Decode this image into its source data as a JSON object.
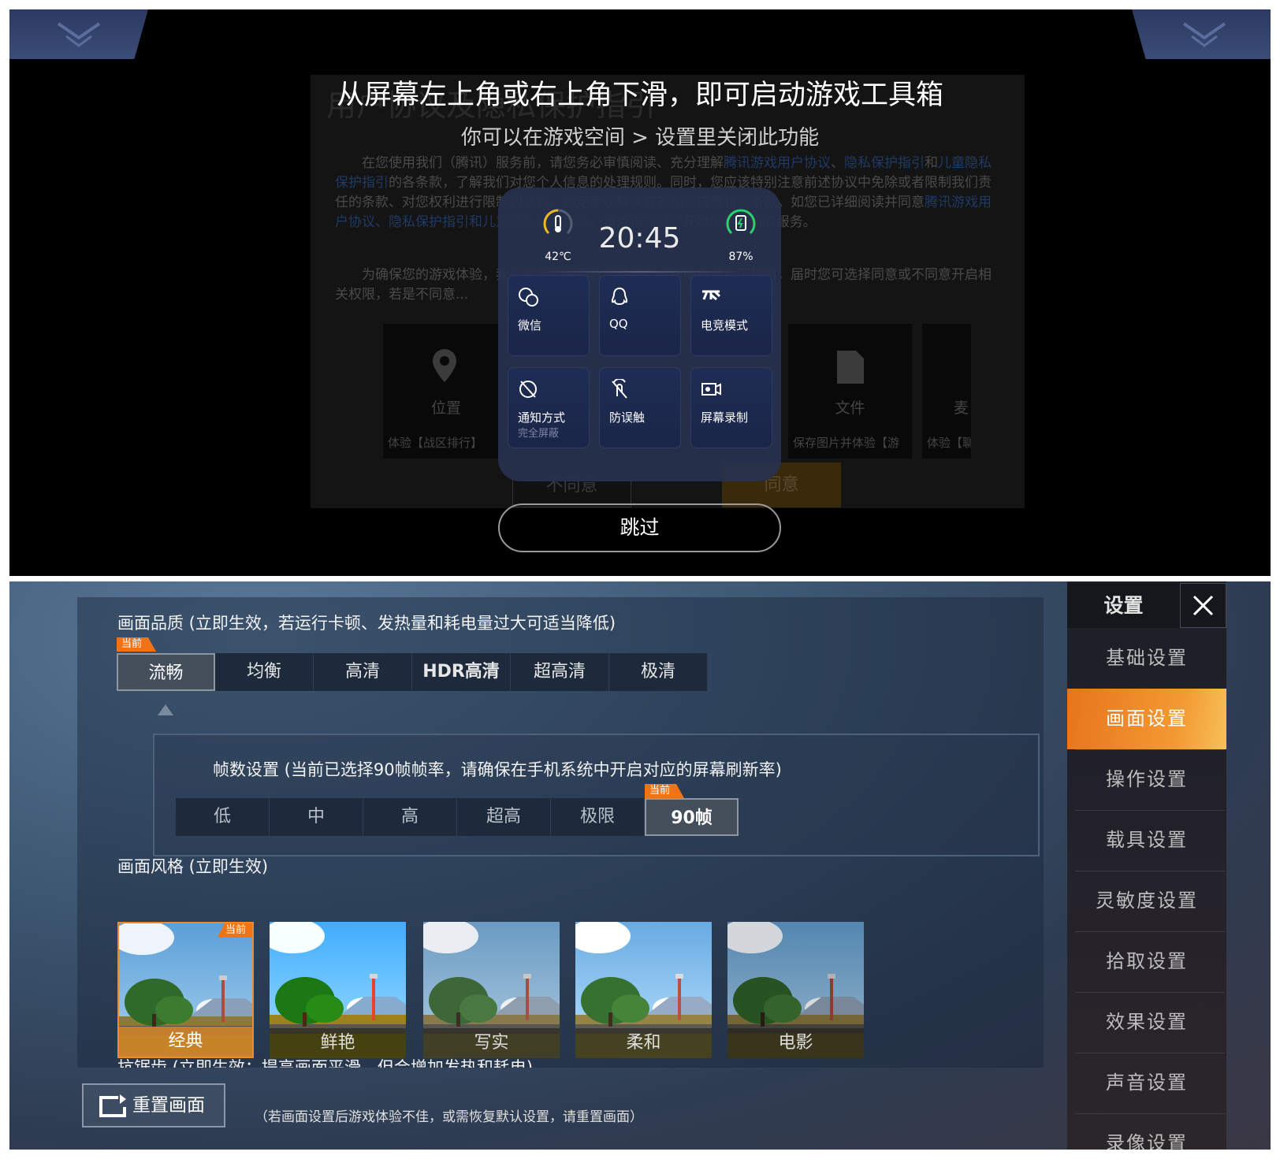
{
  "overlay": {
    "title": "从屏幕左上角或右上角下滑，即可启动游戏工具箱",
    "subtitle": "你可以在游戏空间 > 设置里关闭此功能",
    "skip_label": "跳过"
  },
  "agreement": {
    "title": "用户协议及隐私保护指引",
    "p1_a": "在您使用我们（腾讯）服务前，请您务必审慎阅读、充分理解",
    "p1_link1": "腾讯游戏用户协议",
    "p1_b": "、",
    "p1_link2": "隐私保护指引",
    "p1_c": "和",
    "p1_link3": "儿童隐私保护指引",
    "p1_d": "的各条款，了解我们对您个人信息的处理规则。同时，您应该特别注意前述协议中免除或者限制我们责任的条款、对您权利进行限制的条约、约定争议解决方式和司法管辖的条款。如您已详细阅读并同意",
    "p1_link4": "腾讯游戏用户协议、隐私保护指引和儿童隐私保护指引",
    "p1_e": "，请点击\"同意\"开始使用我们的服务。",
    "p2": "为确保您的游戏体验，我们将在您使用我们的服务过程中申请以下权限，届时您可选择同意或不同意开启相关权限，若是不同意...",
    "permissions": [
      {
        "label": "位置",
        "desc": "体验【战区排行】",
        "icon": "location-pin-icon"
      },
      {
        "label": "文件",
        "desc": "保存图片并体验【游",
        "icon": "file-icon"
      },
      {
        "label": "麦",
        "desc": "体验【聊",
        "icon": "microphone-icon"
      }
    ],
    "disagree_label": "不同意",
    "agree_label": "同意"
  },
  "toolbox": {
    "temperature": "42℃",
    "time": "20:45",
    "battery": "87%",
    "battery_level": 87,
    "tiles": [
      {
        "label": "微信",
        "sub": "",
        "icon": "wechat-icon"
      },
      {
        "label": "QQ",
        "sub": "",
        "icon": "qq-icon"
      },
      {
        "label": "电竞模式",
        "sub": "",
        "icon": "esports-mode-icon"
      },
      {
        "label": "通知方式",
        "sub": "完全屏蔽",
        "icon": "notification-block-icon"
      },
      {
        "label": "防误触",
        "sub": "",
        "icon": "touch-lock-icon"
      },
      {
        "label": "屏幕录制",
        "sub": "",
        "icon": "screen-record-icon"
      }
    ]
  },
  "settings": {
    "current_tag": "当前",
    "quality_title": "画面品质 (立即生效，若运行卡顿、发热量和耗电量过大可适当降低)",
    "quality_options": [
      "流畅",
      "均衡",
      "高清",
      "HDR高清",
      "超高清",
      "极清"
    ],
    "quality_selected": 0,
    "fps_title": "帧数设置 (当前已选择90帧帧率，请确保在手机系统中开启对应的屏幕刷新率)",
    "fps_options": [
      "低",
      "中",
      "高",
      "超高",
      "极限",
      "90帧"
    ],
    "fps_selected": 5,
    "style_title": "画面风格 (立即生效)",
    "style_options": [
      "经典",
      "鲜艳",
      "写实",
      "柔和",
      "电影"
    ],
    "style_selected": 0,
    "aa_title": "抗锯齿 (立即生效：提高画面平滑，但会增加发热和耗电)",
    "reset_label": "重置画面",
    "reset_hint": "（若画面设置后游戏体验不佳，或需恢复默认设置，请重置画面）",
    "sidebar_title": "设置",
    "menu": [
      "基础设置",
      "画面设置",
      "操作设置",
      "载具设置",
      "灵敏度设置",
      "拾取设置",
      "效果设置",
      "声音设置",
      "录像设置"
    ],
    "menu_active": 1,
    "accent": "#f07416"
  }
}
